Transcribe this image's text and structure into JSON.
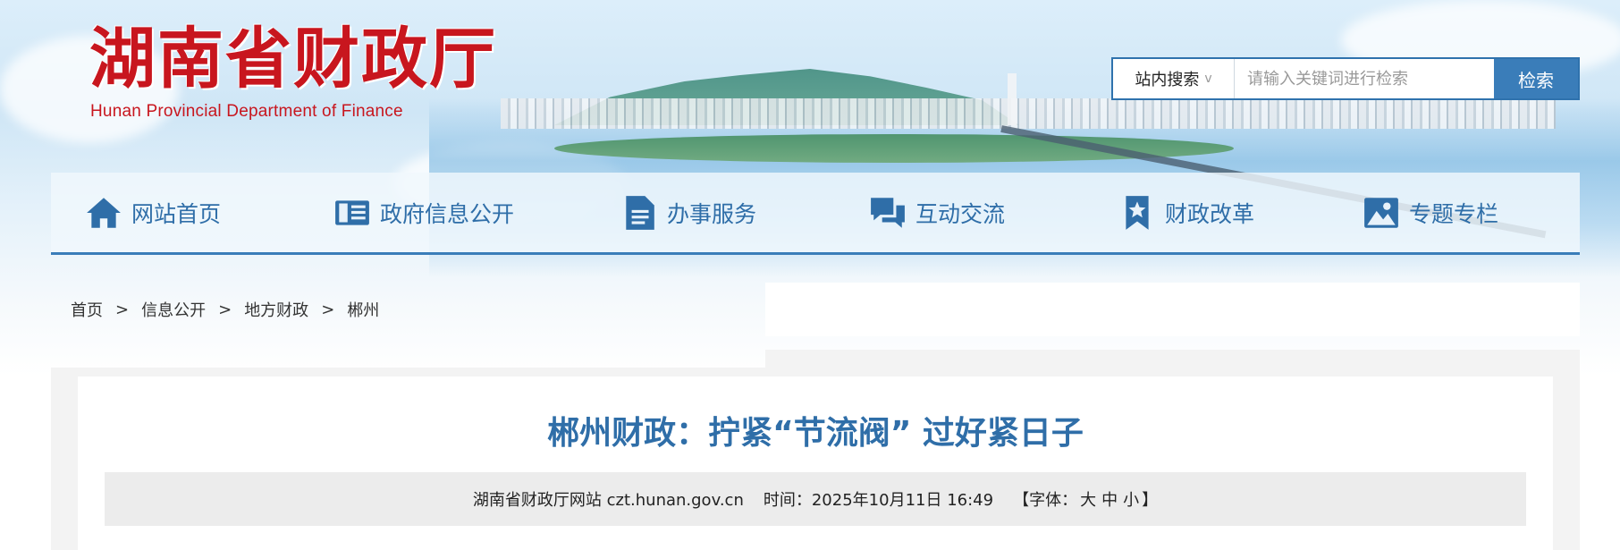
{
  "header": {
    "logo_cn": "湖南省财政厅",
    "logo_en": "Hunan Provincial Department of Finance"
  },
  "search": {
    "scope": "站内搜索",
    "placeholder": "请输入关键词进行检索",
    "button": "检索"
  },
  "nav": {
    "items": [
      {
        "label": "网站首页",
        "icon": "home-icon"
      },
      {
        "label": "政府信息公开",
        "icon": "book-icon"
      },
      {
        "label": "办事服务",
        "icon": "document-icon"
      },
      {
        "label": "互动交流",
        "icon": "chat-icon"
      },
      {
        "label": "财政改革",
        "icon": "bookmark-star-icon"
      },
      {
        "label": "专题专栏",
        "icon": "image-icon"
      }
    ]
  },
  "breadcrumb": {
    "sep": ">",
    "items": [
      "首页",
      "信息公开",
      "地方财政",
      "郴州"
    ]
  },
  "article": {
    "title": "郴州财政：拧紧“节流阀” 过好紧日子",
    "source": "湖南省财政厅网站 czt.hunan.gov.cn",
    "time_label": "时间：",
    "time": "2025年10月11日 16:49",
    "font_open": "【字体：",
    "font_large": "大",
    "font_medium": "中",
    "font_small": "小",
    "font_close": "】"
  },
  "colors": {
    "brand_red": "#c8161e",
    "brand_blue": "#3a7db9",
    "nav_text": "#2f6ea8"
  }
}
